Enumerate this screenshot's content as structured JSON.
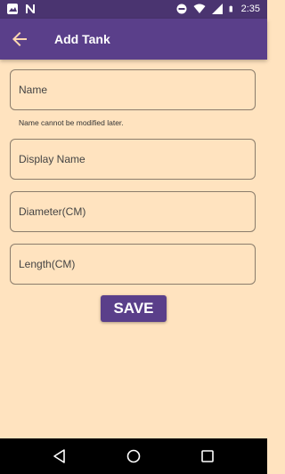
{
  "status_bar": {
    "time": "2:35",
    "left_icons": [
      "image-icon",
      "n-notification-icon"
    ],
    "right_icons": [
      "dnd-icon",
      "wifi-icon",
      "signal-icon",
      "battery-icon"
    ]
  },
  "app_bar": {
    "title": "Add Tank",
    "back_icon": "back-arrow-icon"
  },
  "form": {
    "name_placeholder": "Name",
    "name_helper": "Name cannot be modified later.",
    "display_name_placeholder": "Display Name",
    "diameter_placeholder": "Diameter(CM)",
    "length_placeholder": "Length(CM)",
    "save_label": "SAVE"
  },
  "nav_bar": {
    "icons": [
      "nav-back-icon",
      "nav-home-icon",
      "nav-recents-icon"
    ]
  },
  "colors": {
    "background": "#ffe3bf",
    "app_bar": "#5a3f8a",
    "status_bar": "#4a3470",
    "button": "#5a3f8a"
  }
}
